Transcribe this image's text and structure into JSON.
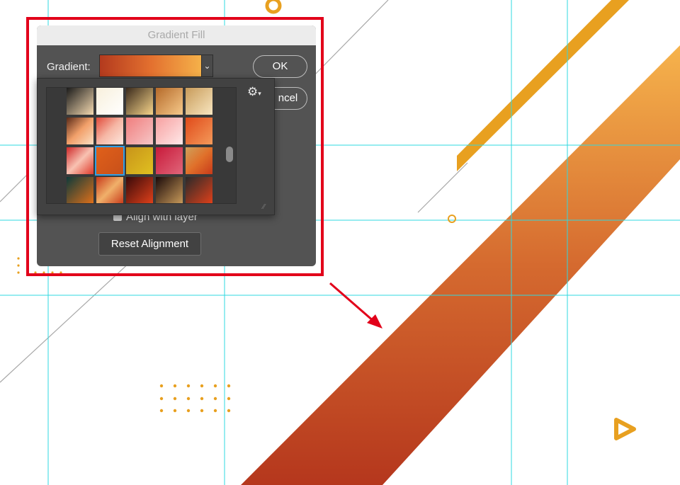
{
  "dialog": {
    "title": "Gradient Fill",
    "gradient_label": "Gradient:",
    "ok_label": "OK",
    "cancel_label": "ncel",
    "align_label": "Align with layer",
    "reset_label": "Reset Alignment",
    "chevron_icon": "chevron-down-icon",
    "gear_icon": "gear-icon",
    "gear_glyph": "⚙",
    "gear_caret": "▾",
    "resize_glyph": "⁄⁄"
  },
  "swatches": [
    {
      "name": "swatch-1",
      "colors": [
        "#1b1b1b",
        "#f4d9b0"
      ]
    },
    {
      "name": "swatch-2",
      "colors": [
        "#f8f0dc",
        "#ffffff"
      ]
    },
    {
      "name": "swatch-3",
      "colors": [
        "#3a2a1c",
        "#f6d48a"
      ]
    },
    {
      "name": "swatch-4",
      "colors": [
        "#b56a2a",
        "#f6c98a"
      ]
    },
    {
      "name": "swatch-5",
      "colors": [
        "#c89b5a",
        "#f8e6c0"
      ]
    },
    {
      "name": "swatch-6",
      "colors": [
        "#5a2a18",
        "#f2a06a",
        "#fbe0c4"
      ]
    },
    {
      "name": "swatch-7",
      "colors": [
        "#e04a3a",
        "#f6b7a5",
        "#fde7de"
      ]
    },
    {
      "name": "swatch-8",
      "colors": [
        "#f07d7d",
        "#f6c6c6"
      ]
    },
    {
      "name": "swatch-9",
      "colors": [
        "#f7a0a0",
        "#ffe8e8"
      ]
    },
    {
      "name": "swatch-10",
      "colors": [
        "#e04a1a",
        "#f49a5a"
      ]
    },
    {
      "name": "swatch-11",
      "colors": [
        "#cf2a2a",
        "#f8c2b2",
        "#e03a2a"
      ]
    },
    {
      "name": "swatch-12",
      "colors": [
        "#e0601a",
        "#c8501a"
      ]
    },
    {
      "name": "swatch-13",
      "colors": [
        "#c8941a",
        "#e0c020"
      ]
    },
    {
      "name": "swatch-14",
      "colors": [
        "#c81a3a",
        "#e0667a"
      ]
    },
    {
      "name": "swatch-15",
      "colors": [
        "#cfa05a",
        "#e0702a",
        "#c83a1a"
      ]
    },
    {
      "name": "swatch-16",
      "colors": [
        "#0f3a3a",
        "#e0701a"
      ]
    },
    {
      "name": "swatch-17",
      "colors": [
        "#c83a1a",
        "#f0b06a",
        "#c83a1a"
      ]
    },
    {
      "name": "swatch-18",
      "colors": [
        "#3a0a0a",
        "#e0401a"
      ]
    },
    {
      "name": "swatch-19",
      "colors": [
        "#1a0a0a",
        "#c89a5a"
      ]
    },
    {
      "name": "swatch-20",
      "colors": [
        "#2a2a2a",
        "#e0401a"
      ]
    },
    {
      "name": "swatch-21",
      "colors": [
        "#e03a5a",
        "#f0a0c0"
      ]
    },
    {
      "name": "swatch-22",
      "colors": [
        "#1a0a0a",
        "#c81a1a"
      ]
    },
    {
      "name": "swatch-23",
      "colors": [
        "#3a0a1a",
        "#e01a5a"
      ]
    },
    {
      "name": "swatch-24",
      "colors": [
        "#e0a0c0",
        "#2a0a0a"
      ]
    },
    {
      "name": "swatch-25",
      "colors": [
        "#e06ab0",
        "#f8c0e0"
      ]
    }
  ],
  "selected_swatch_index": 11,
  "colors": {
    "guide": "#2fd8e0",
    "highlight": "#e2001a",
    "arrow": "#e2001a",
    "orange": "#e8a020",
    "gradient_dark": "#b5371d",
    "gradient_light": "#f6b34c",
    "gray_line": "#a0a0a0"
  }
}
